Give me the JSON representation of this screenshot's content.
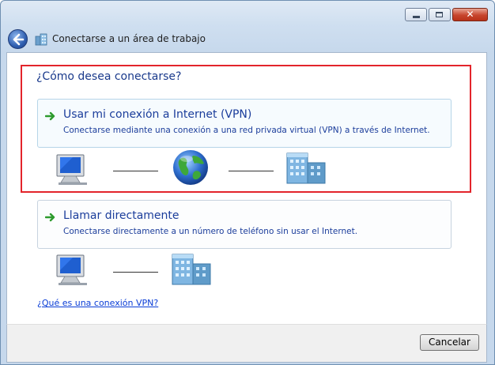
{
  "window": {
    "title": "Conectarse a un área de trabajo",
    "controls": [
      "minimize",
      "maximize",
      "close"
    ]
  },
  "main": {
    "question": "¿Cómo desea conectarse?",
    "options": [
      {
        "title": "Usar mi conexión a Internet (VPN)",
        "description": "Conectarse mediante una conexión a una red privada virtual (VPN) a través de Internet.",
        "icons": [
          "computer-icon",
          "internet-globe-icon",
          "workplace-building-icon"
        ],
        "highlighted": true
      },
      {
        "title": "Llamar directamente",
        "description": "Conectarse directamente a un número de teléfono sin usar el Internet.",
        "icons": [
          "computer-icon",
          "workplace-building-icon"
        ],
        "highlighted": false
      }
    ],
    "help_link": "¿Qué es una conexión VPN?"
  },
  "footer": {
    "cancel_label": "Cancelar"
  },
  "colors": {
    "link_blue": "#1b3d9b",
    "highlight_red": "#e3242b",
    "arrow_green": "#2e9b2e"
  }
}
